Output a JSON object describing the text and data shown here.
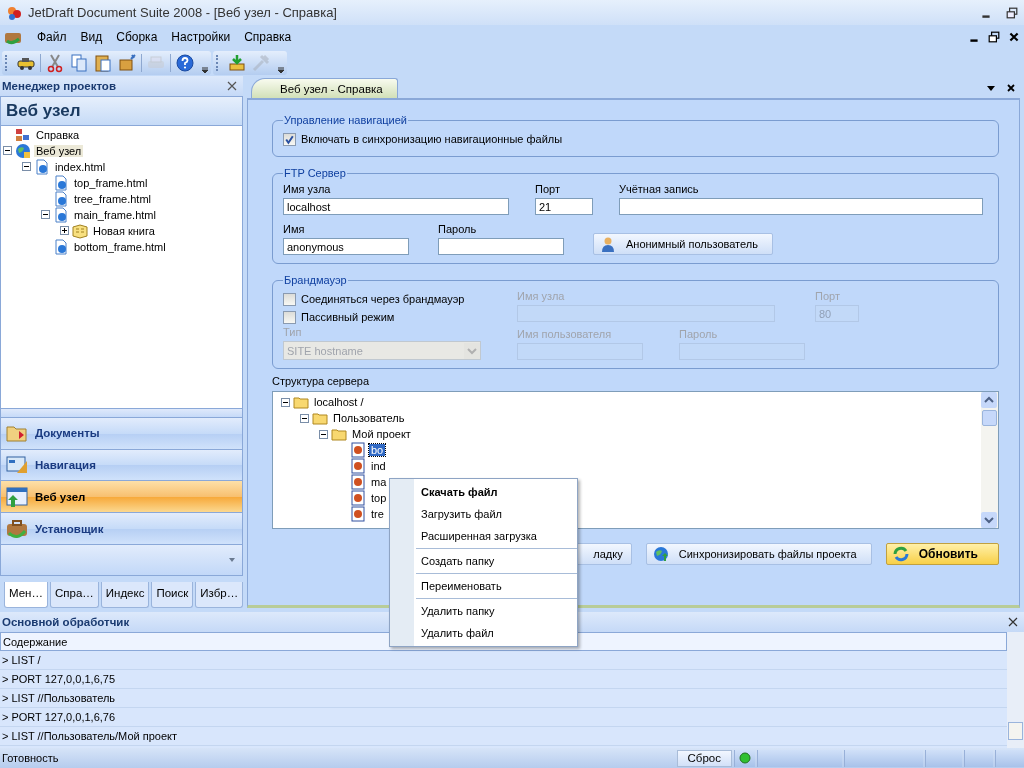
{
  "window": {
    "title": "JetDraft Document Suite 2008 - [Веб узел - Справка]"
  },
  "menu": [
    {
      "label": "Файл"
    },
    {
      "label": "Вид"
    },
    {
      "label": "Сборка"
    },
    {
      "label": "Настройки"
    },
    {
      "label": "Справка"
    }
  ],
  "toolbar": [
    [
      {
        "disabled": false
      }
    ],
    [
      {
        "disabled": false
      },
      {
        "disabled": false
      },
      {
        "disabled": false
      },
      {
        "disabled": false
      }
    ],
    [
      {
        "disabled": true
      }
    ],
    [
      {
        "disabled": false
      }
    ],
    [
      {
        "disabled": false
      },
      {
        "disabled": true
      }
    ]
  ],
  "project_manager": {
    "title": "Менеджер проектов",
    "heading": "Веб узел",
    "tree": [
      {
        "label": "Справка",
        "kind": "project"
      },
      {
        "label": "Веб узел",
        "kind": "site",
        "expanded": true,
        "selected": true,
        "children": [
          {
            "label": "index.html",
            "kind": "page",
            "expanded": true,
            "children": [
              {
                "label": "top_frame.html",
                "kind": "page"
              },
              {
                "label": "tree_frame.html",
                "kind": "page"
              },
              {
                "label": "main_frame.html",
                "kind": "page",
                "expanded": true,
                "children": [
                  {
                    "label": "Новая книга",
                    "kind": "book",
                    "expanded": false
                  }
                ]
              },
              {
                "label": "bottom_frame.html",
                "kind": "page"
              }
            ]
          }
        ]
      }
    ],
    "sections": [
      {
        "label": "Документы",
        "kind": "documents",
        "selected": false
      },
      {
        "label": "Навигация",
        "kind": "navigation",
        "selected": false
      },
      {
        "label": "Веб узел",
        "kind": "web",
        "selected": true
      },
      {
        "label": "Установщик",
        "kind": "installer",
        "selected": false
      }
    ],
    "tabs": [
      {
        "label": "Мен…",
        "selected": true
      },
      {
        "label": "Спра…",
        "selected": false
      },
      {
        "label": "Индекс",
        "selected": false
      },
      {
        "label": "Поиск",
        "selected": false
      },
      {
        "label": "Избр…",
        "selected": false
      }
    ]
  },
  "document_tab": {
    "label": "Веб узел - Справка",
    "selected": true
  },
  "navigation": {
    "title": "Управление навигацией",
    "sync_checkbox": {
      "label": "Включать в синхронизацию навигационные файлы",
      "checked": true
    }
  },
  "ftp": {
    "title": "FTP Сервер",
    "host": {
      "label": "Имя узла",
      "value": "localhost"
    },
    "port": {
      "label": "Порт",
      "value": "21"
    },
    "account": {
      "label": "Учётная запись"
    },
    "user": {
      "label": "Имя",
      "value": "anonymous"
    },
    "password": {
      "label": "Пароль"
    },
    "anonymous_button": "Анонимный пользователь"
  },
  "firewall": {
    "title": "Брандмауэр",
    "disabled": true,
    "connect_checkbox": {
      "label": "Соединяться через брандмауэр",
      "checked": false
    },
    "passive_checkbox": {
      "label": "Пассивный режим",
      "checked": false
    },
    "type": {
      "label": "Тип",
      "value": "SITE hostname"
    },
    "host": {
      "label": "Имя узла"
    },
    "port": {
      "label": "Порт",
      "value": "80"
    },
    "user": {
      "label": "Имя пользователя"
    },
    "password": {
      "label": "Пароль"
    }
  },
  "server": {
    "title": "Структура сервера",
    "tree": [
      {
        "label": "localhost /",
        "kind": "folder",
        "expanded": true,
        "children": [
          {
            "label": "Пользователь",
            "kind": "folder",
            "expanded": true,
            "children": [
              {
                "label": "Мой проект",
                "kind": "folder",
                "expanded": true,
                "children": [
                  {
                    "label": "bo",
                    "kind": "file",
                    "selected": true
                  },
                  {
                    "label": "ind",
                    "kind": "file",
                    "selected": false
                  },
                  {
                    "label": "ma",
                    "kind": "file",
                    "selected": false
                  },
                  {
                    "label": "top",
                    "kind": "file",
                    "selected": false
                  },
                  {
                    "label": "tre",
                    "kind": "file",
                    "selected": false
                  }
                ]
              }
            ]
          }
        ]
      }
    ]
  },
  "buttons": [
    {
      "label": "ладку",
      "primary": false,
      "kind": "plain"
    },
    {
      "label": "Синхронизировать файлы проекта",
      "primary": false,
      "kind": "sync"
    },
    {
      "label": "Обновить",
      "primary": true,
      "kind": "refresh"
    }
  ],
  "context_menu": [
    [
      {
        "label": "Скачать файл",
        "default": true
      },
      {
        "label": "Загрузить файл",
        "default": false
      },
      {
        "label": "Расширенная загрузка",
        "default": false
      }
    ],
    [
      {
        "label": "Создать папку",
        "default": false
      }
    ],
    [
      {
        "label": "Переименовать",
        "default": false
      }
    ],
    [
      {
        "label": "Удалить папку",
        "default": false
      },
      {
        "label": "Удалить файл",
        "default": false
      }
    ]
  ],
  "output": {
    "title": "Основной обработчик",
    "column": "Содержание",
    "rows": [
      "> LIST /",
      "> PORT 127,0,0,1,6,75",
      "> LIST //Пользователь",
      "> PORT 127,0,0,1,6,76",
      "> LIST //Пользователь/Мой проект"
    ]
  },
  "status_bar": {
    "text": "Готовность",
    "reset_button": "Сброс",
    "connected": true
  }
}
